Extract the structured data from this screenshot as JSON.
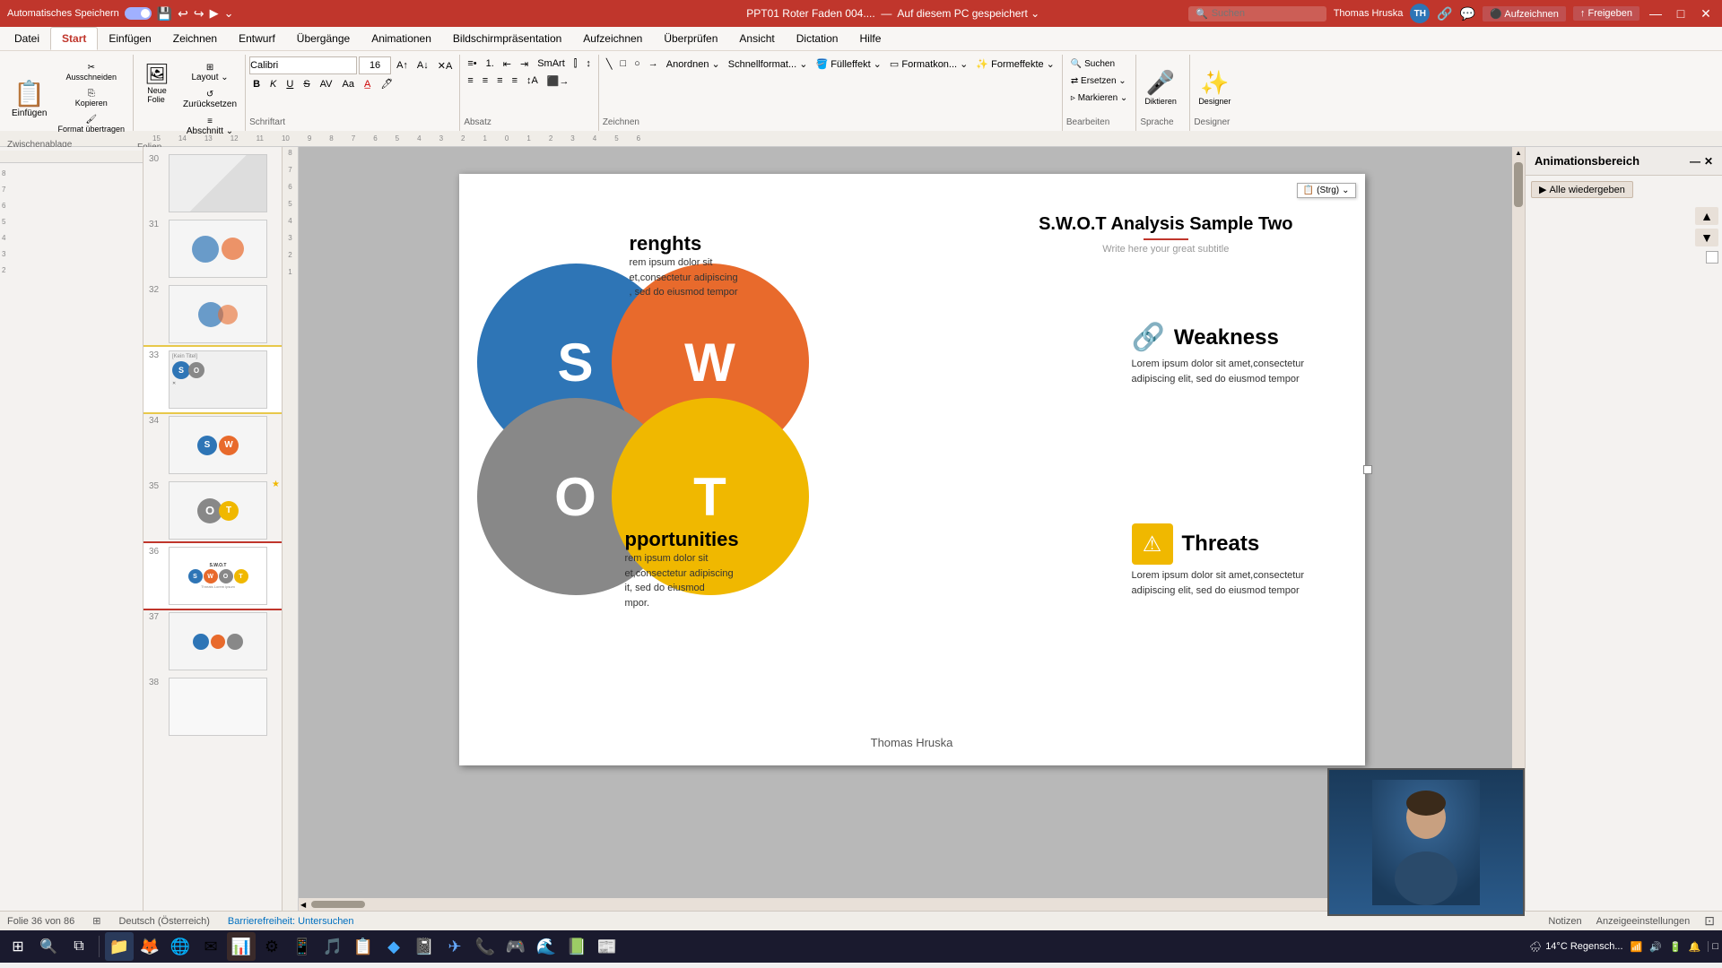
{
  "titleBar": {
    "autoSave": "Automatisches Speichern",
    "fileName": "PPT01 Roter Faden 004....",
    "saveStatus": "Auf diesem PC gespeichert",
    "user": "Thomas Hruska",
    "userInitials": "TH",
    "searchPlaceholder": "Suchen",
    "windowControls": [
      "—",
      "□",
      "✕"
    ]
  },
  "menuBar": {
    "items": [
      "Datei",
      "Start",
      "Einfügen",
      "Zeichnen",
      "Entwurf",
      "Übergänge",
      "Animationen",
      "Bildschirmpräsentation",
      "Aufzeichnen",
      "Überprüfen",
      "Ansicht",
      "Dictation",
      "Hilfe"
    ]
  },
  "activeTab": "Start",
  "ribbon": {
    "groups": [
      {
        "label": "Zwischenablage",
        "buttons": [
          "Einfügen",
          "Ausschneiden",
          "Kopieren",
          "Format übertragen"
        ]
      },
      {
        "label": "Folien",
        "buttons": [
          "Neue Folie",
          "Layout",
          "Zurücksetzen",
          "Abschnitt"
        ]
      },
      {
        "label": "Schriftart",
        "buttons": [
          "F",
          "K",
          "U",
          "S"
        ]
      },
      {
        "label": "Absatz",
        "buttons": [
          "list",
          "align"
        ]
      },
      {
        "label": "Zeichnen",
        "buttons": [
          "shapes"
        ]
      },
      {
        "label": "Bearbeiten",
        "buttons": [
          "Suchen",
          "Ersetzen",
          "Markieren"
        ]
      },
      {
        "label": "Sprache",
        "buttons": [
          "Diktieren"
        ]
      },
      {
        "label": "Designer",
        "buttons": [
          "Designer"
        ]
      }
    ]
  },
  "animPanel": {
    "title": "Animationsbereich",
    "playAllBtn": "Alle wiedergeben"
  },
  "slidePanel": {
    "slides": [
      {
        "num": 30,
        "hasStar": false
      },
      {
        "num": 31,
        "hasStar": false
      },
      {
        "num": 32,
        "hasStar": false
      },
      {
        "num": 33,
        "hasStar": false,
        "noTitle": "[Kein Titel]",
        "active": true
      },
      {
        "num": 34,
        "hasStar": false
      },
      {
        "num": 35,
        "hasStar": true
      },
      {
        "num": 36,
        "hasStar": false,
        "current": true
      },
      {
        "num": 37,
        "hasStar": false
      },
      {
        "num": 38,
        "hasStar": false
      }
    ]
  },
  "slide": {
    "title": "S.W.O.T Analysis Sample Two",
    "subtitle": "Write here your great subtitle",
    "strengths": {
      "heading": "Strengths",
      "body": "Lorem ipsum dolor sit amet,consectetur adipiscing , sed do eiusmod tempor"
    },
    "opportunities": {
      "heading": "Opportunities",
      "body": "Lorem ipsum dolor sit amet,consectetur adipiscing elit, sed do eiusmod tempor."
    },
    "weakness": {
      "heading": "Weakness",
      "body": "Lorem ipsum dolor sit amet,consectetur adipiscing elit, sed do eiusmod tempor"
    },
    "threats": {
      "heading": "Threats",
      "body": "Lorem ipsum dolor sit amet,consectetur adipiscing elit, sed do eiusmod tempor"
    },
    "author": "Thomas Hruska",
    "swotLetters": [
      "S",
      "W",
      "O",
      "T"
    ],
    "pasteTooltip": "(Strg)"
  },
  "statusBar": {
    "slideInfo": "Folie 36 von 86",
    "language": "Deutsch (Österreich)",
    "accessibility": "Barrierefreiheit: Untersuchen",
    "notes": "Notizen",
    "displaySettings": "Anzeigeeinstellungen"
  },
  "taskbar": {
    "items": [
      "⊞",
      "📁",
      "🦊",
      "🌐",
      "✉",
      "📊",
      "⚙",
      "📱",
      "🎵",
      "📋",
      "🔷",
      "📓",
      "✈",
      "📞",
      "🎮",
      "🔵",
      "📰"
    ],
    "time": "14°C Regensch...",
    "clock": ""
  }
}
